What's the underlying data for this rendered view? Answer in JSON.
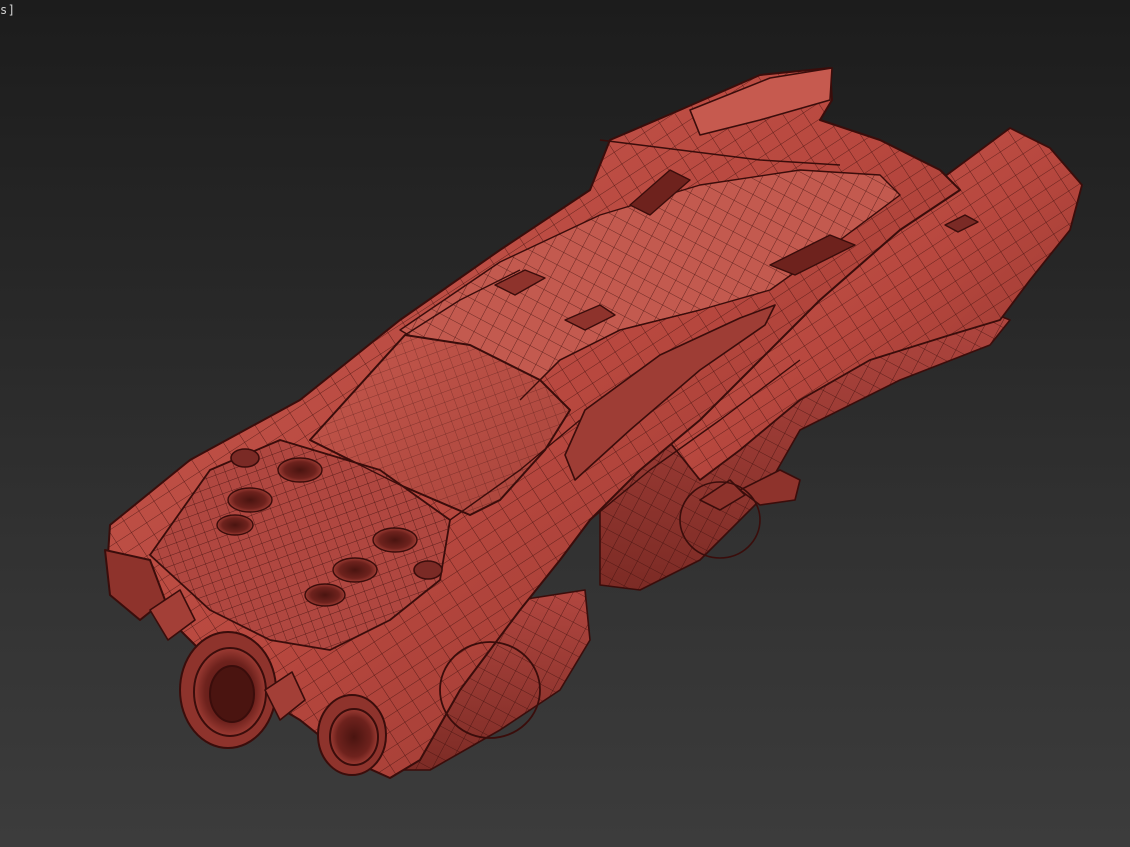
{
  "viewport": {
    "label": "s]",
    "background_top": "#1c1c1c",
    "background_bottom": "#3c3c3c"
  },
  "model": {
    "object": "hover-car-wireframe",
    "shading": "edged-faces",
    "fill_color": "#b8483f",
    "highlight_color": "#cf6a5e",
    "shadow_color": "#7a2a25",
    "wire_color": "#3a0d0b"
  }
}
